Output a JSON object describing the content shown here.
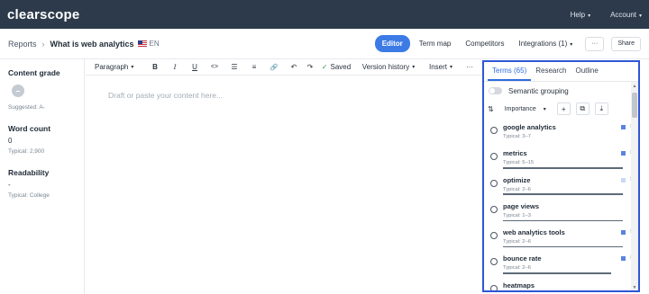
{
  "app": {
    "logo": "clearscope"
  },
  "topnav": {
    "help": "Help",
    "account": "Account"
  },
  "header": {
    "breadcrumb_root": "Reports",
    "separator": "›",
    "title": "What is web analytics",
    "lang": "EN",
    "tabs": [
      "Editor",
      "Term map",
      "Competitors",
      "Integrations (1)"
    ],
    "more": "···",
    "share": "Share"
  },
  "metrics": {
    "content_grade": {
      "label": "Content grade",
      "suggested": "Suggested: A-"
    },
    "word_count": {
      "label": "Word count",
      "value": "0",
      "typical": "Typical: 2,900"
    },
    "readability": {
      "label": "Readability",
      "value": "-",
      "typical": "Typical: College"
    }
  },
  "toolbar": {
    "paragraph": "Paragraph",
    "bold": "B",
    "italic": "I",
    "underline": "U",
    "code": "<>",
    "bullet_list": "☰",
    "numbered_list": "≡",
    "link": "🔗",
    "undo": "↶",
    "redo": "↷",
    "saved_check": "✓",
    "saved": "Saved",
    "version_history": "Version history",
    "insert": "Insert",
    "more": "···"
  },
  "editor": {
    "placeholder": "Draft or paste your content here..."
  },
  "terms_panel": {
    "tabs": [
      "Terms (65)",
      "Research",
      "Outline"
    ],
    "semantic_grouping": "Semantic grouping",
    "sort_icon": "⇅",
    "sort_label": "Importance",
    "add": "+",
    "copy": "⧉",
    "export": "⤓",
    "colors": {
      "mark_strong": "#5b82e0",
      "mark_weak": "#c9d9f3",
      "accent": "#2f6bdc"
    },
    "items": [
      {
        "name": "google analytics",
        "typical": "Typical: 3–7",
        "flag": "H",
        "mark": "strong",
        "bar": 0
      },
      {
        "name": "metrics",
        "typical": "Typical: 5–15",
        "flag": "H",
        "mark": "strong",
        "bar": 1
      },
      {
        "name": "optimize",
        "typical": "Typical: 2–6",
        "flag": "H",
        "mark": "weak",
        "bar": 1
      },
      {
        "name": "page views",
        "typical": "Typical: 1–3",
        "flag": "",
        "mark": "none",
        "bar": 1
      },
      {
        "name": "web analytics tools",
        "typical": "Typical: 2–6",
        "flag": "H",
        "mark": "strong",
        "bar": 1
      },
      {
        "name": "bounce rate",
        "typical": "Typical: 2–6",
        "flag": "H",
        "mark": "strong",
        "bar": 0.9
      },
      {
        "name": "heatmaps",
        "typical": "",
        "flag": "",
        "mark": "none",
        "bar": 0
      }
    ]
  }
}
